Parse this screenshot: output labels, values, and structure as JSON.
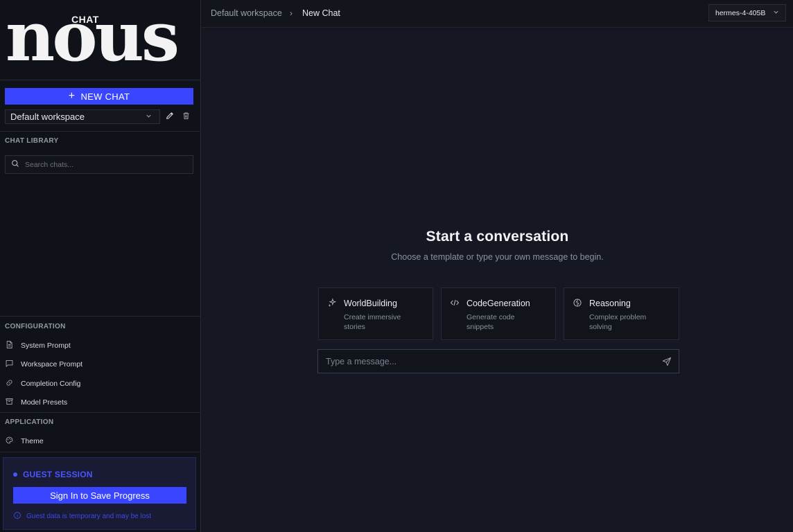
{
  "logo": {
    "tag": "CHAT",
    "word": "nous"
  },
  "sidebar": {
    "new_chat_label": "NEW CHAT",
    "workspace_value": "Default workspace",
    "chat_library_label": "CHAT LIBRARY",
    "search_placeholder": "Search chats...",
    "configuration_label": "CONFIGURATION",
    "config_items": [
      {
        "label": "System Prompt",
        "icon": "document-icon"
      },
      {
        "label": "Workspace Prompt",
        "icon": "message-square-icon"
      },
      {
        "label": "Completion Config",
        "icon": "link-icon"
      },
      {
        "label": "Model Presets",
        "icon": "archive-icon"
      }
    ],
    "application_label": "APPLICATION",
    "app_items": [
      {
        "label": "Theme",
        "icon": "palette-icon"
      }
    ],
    "guest": {
      "title": "GUEST SESSION",
      "signin_label": "Sign In to Save Progress",
      "note": "Guest data is temporary and may be lost"
    }
  },
  "header": {
    "breadcrumb_workspace": "Default workspace",
    "breadcrumb_separator": "›",
    "breadcrumb_current": "New Chat",
    "model": "hermes-4-405B"
  },
  "main": {
    "heading": "Start a conversation",
    "subheading": "Choose a template or type your own message to begin.",
    "templates": [
      {
        "title": "WorldBuilding",
        "desc": "Create immersive stories",
        "icon": "sparkles-icon"
      },
      {
        "title": "CodeGeneration",
        "desc": "Generate code snippets",
        "icon": "code-icon"
      },
      {
        "title": "Reasoning",
        "desc": "Complex problem solving",
        "icon": "brain-icon"
      }
    ],
    "message_placeholder": "Type a message..."
  },
  "colors": {
    "accent": "#3a45ff",
    "background": "#13151d",
    "sidebar": "#101219"
  }
}
